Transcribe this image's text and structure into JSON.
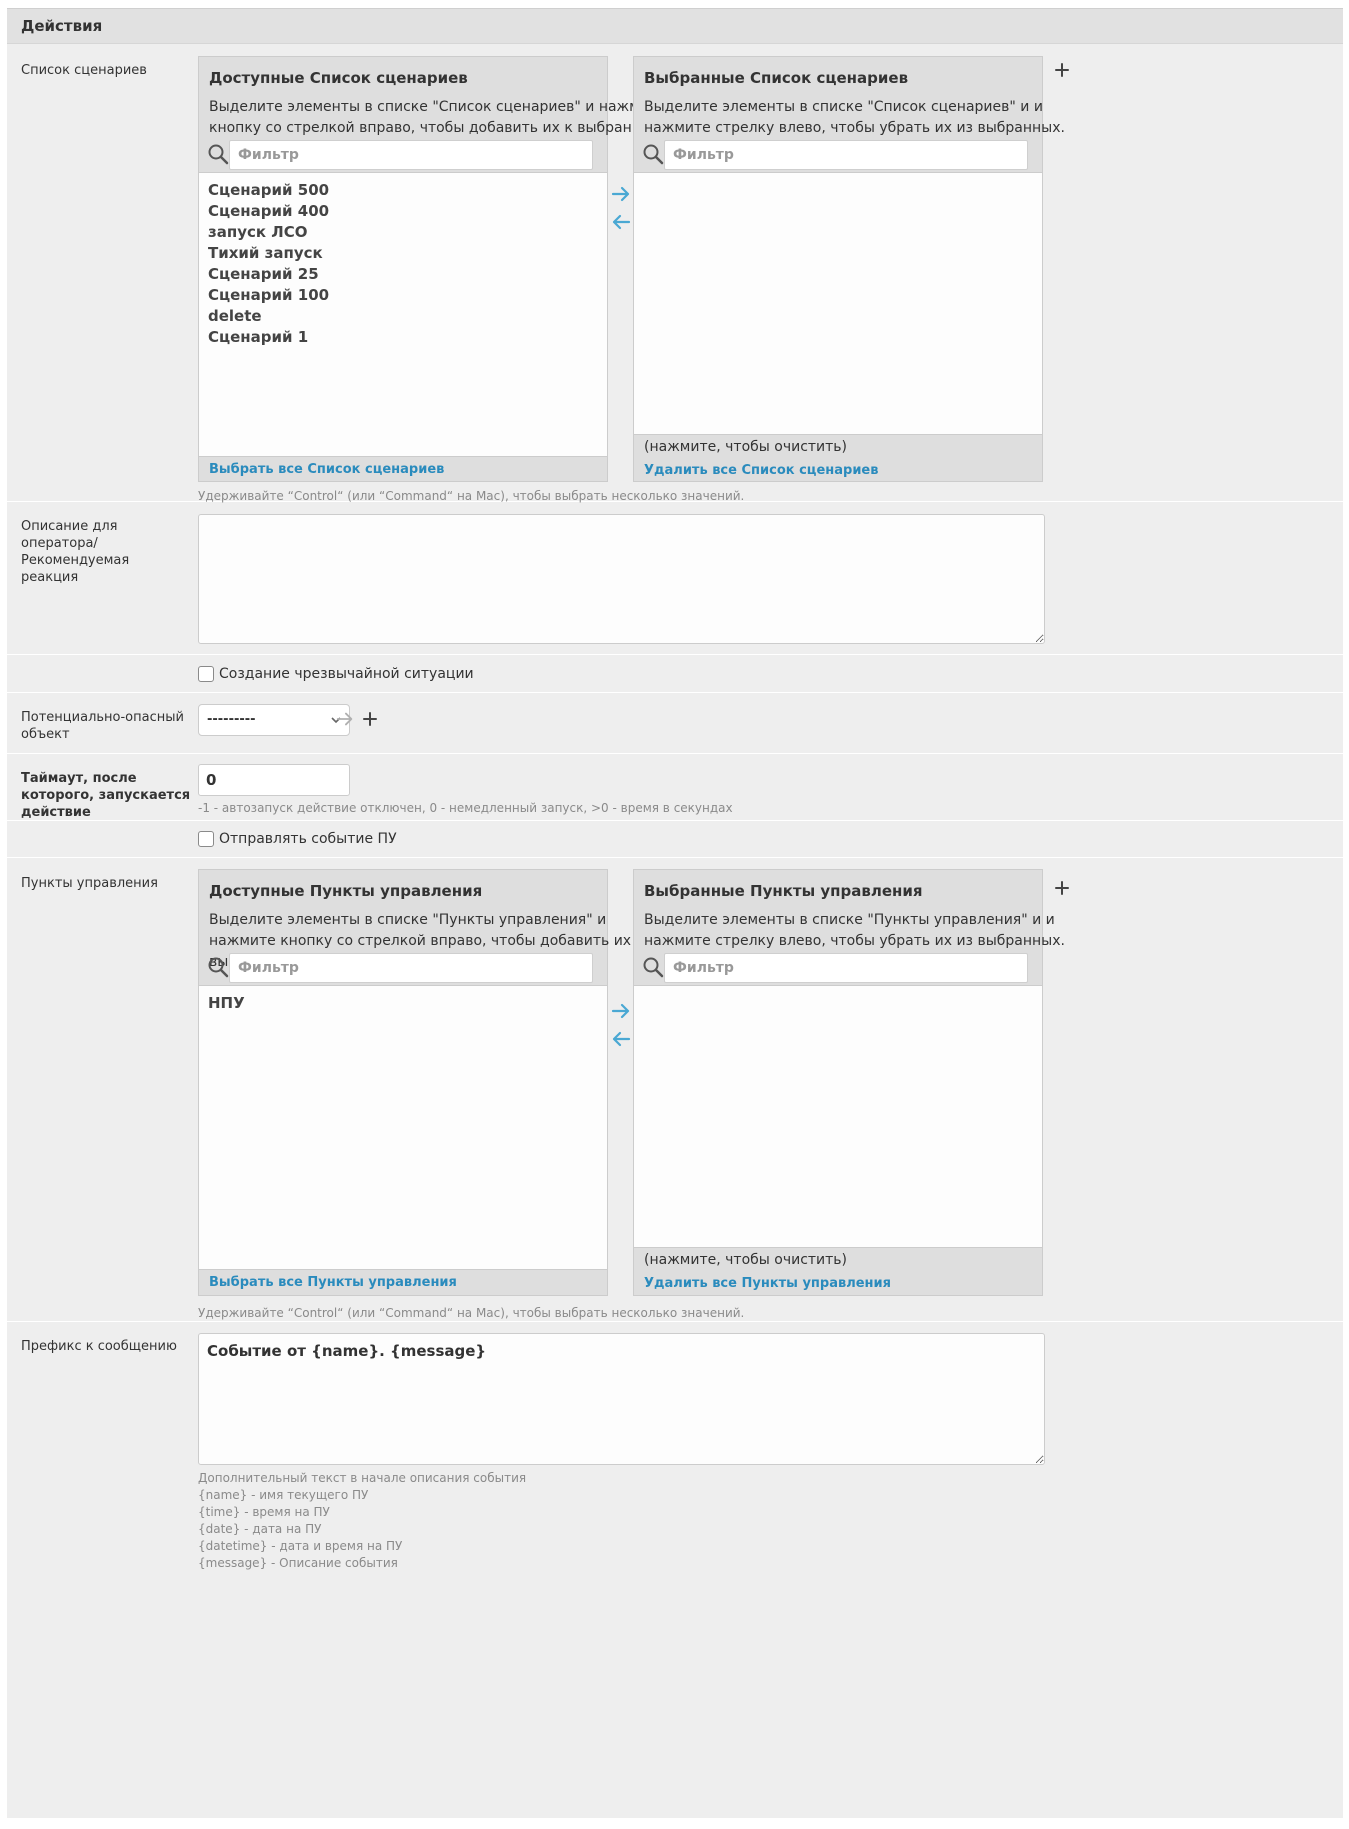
{
  "fieldset": {
    "title": "Действия"
  },
  "scenarios": {
    "label": "Список сценариев",
    "available": {
      "title": "Доступные Список сценариев",
      "help": "Выделите элементы в списке \"Список сценариев\" и нажмите кнопку со стрелкой вправо, чтобы добавить их к выбранным.",
      "filter_placeholder": "Фильтр",
      "options": [
        "Сценарий 500",
        "Сценарий 400",
        "запуск ЛСО",
        "Тихий запуск",
        "Сценарий 25",
        "Сценарий 100",
        "delete",
        "Сценарий 1"
      ],
      "choose_all": "Выбрать все Список сценариев"
    },
    "chosen": {
      "title": "Выбранные Список сценариев",
      "help": "Выделите элементы в списке \"Список сценариев\" и и нажмите стрелку влево, чтобы убрать их из выбранных.",
      "filter_placeholder": "Фильтр",
      "clear_hint": "(нажмите, чтобы очистить)",
      "remove_all": "Удалить все Список сценариев"
    },
    "help": "Удерживайте “Control“ (или “Command“ на Mac), чтобы выбрать несколько значений."
  },
  "operator_desc": {
    "label": "Описание для оператора/ Рекомендуемая реакция",
    "value": ""
  },
  "emergency": {
    "label": "Создание чрезвычайной ситуации"
  },
  "hazard_object": {
    "label": "Потенциально-опасный объект",
    "selected": "---------"
  },
  "timeout": {
    "label": "Таймаут, после которого, запускается действие",
    "value": "0",
    "help": "-1 - автозапуск действие отключен, 0 - немедленный запуск, >0 - время в секундах"
  },
  "send_event": {
    "label": "Отправлять событие ПУ"
  },
  "control_points": {
    "label": "Пункты управления",
    "available": {
      "title": "Доступные Пункты управления",
      "help": "Выделите элементы в списке \"Пункты управления\" и нажмите кнопку со стрелкой вправо, чтобы добавить их к выбранным.",
      "filter_placeholder": "Фильтр",
      "options": [
        "НПУ"
      ],
      "choose_all": "Выбрать все Пункты управления"
    },
    "chosen": {
      "title": "Выбранные Пункты управления",
      "help": "Выделите элементы в списке \"Пункты управления\" и и нажмите стрелку влево, чтобы убрать их из выбранных.",
      "filter_placeholder": "Фильтр",
      "clear_hint": "(нажмите, чтобы очистить)",
      "remove_all": "Удалить все Пункты управления"
    },
    "help": "Удерживайте “Control“ (или “Command“ на Mac), чтобы выбрать несколько значений."
  },
  "prefix": {
    "label": "Префикс к сообщению",
    "value": "Событие от {name}. {message}",
    "help_lines": [
      "Дополнительный текст в начале описания события",
      "{name} - имя текущего ПУ",
      "{time} - время на ПУ",
      "{date} - дата на ПУ",
      "{datetime} - дата и время на ПУ",
      "{message} - Описание события"
    ]
  },
  "colors": {
    "link": "#2a8bbd",
    "arrow": "#4aa8d3",
    "background": "#eeeeee",
    "panel": "#dedede"
  }
}
